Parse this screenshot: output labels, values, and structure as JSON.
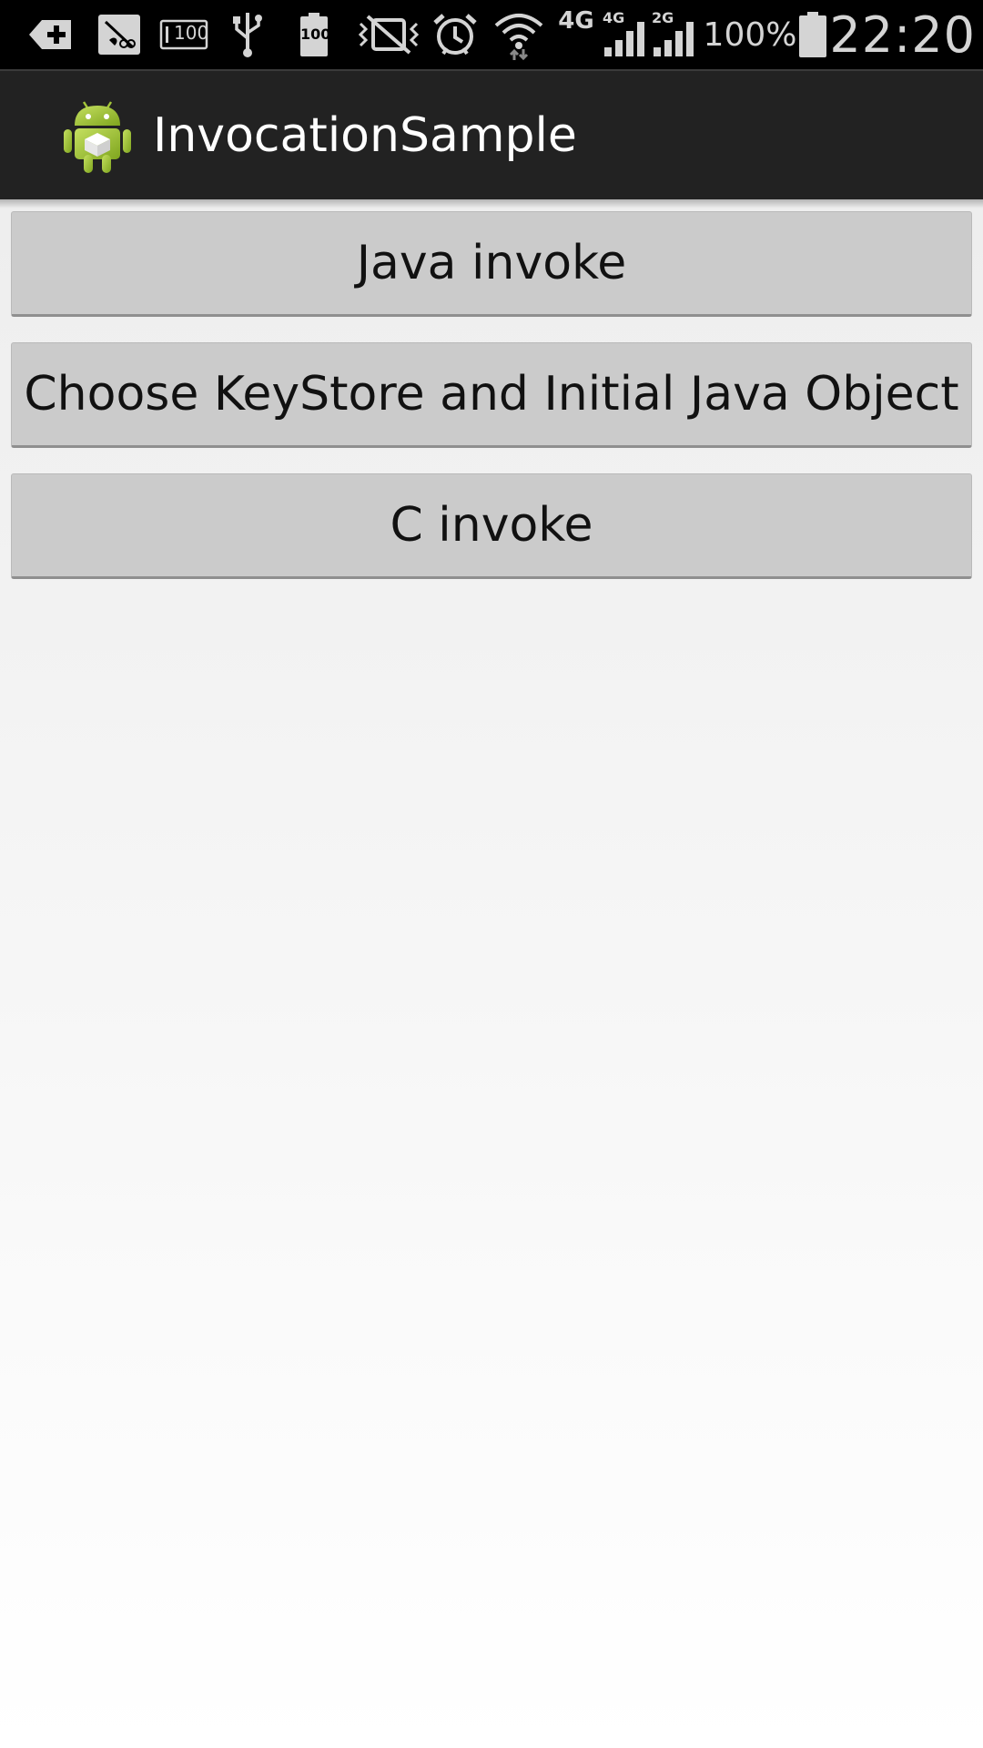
{
  "status_bar": {
    "icons": [
      "add-notification-icon",
      "screenshot-icon",
      "storage-100-icon",
      "usb-icon",
      "battery-100-icon",
      "mute-vibrate-icon",
      "alarm-icon",
      "wifi-icon",
      "signal-4g-icon",
      "signal-2g-icon",
      "battery-icon"
    ],
    "small_badge": "100",
    "net_label": "4G",
    "sim1_label": "4G",
    "sim2_label": "2G",
    "battery_pct": "100%",
    "clock": "22:20"
  },
  "action_bar": {
    "app_title": "InvocationSample",
    "icon": "android-app-icon"
  },
  "buttons": {
    "java_invoke": "Java invoke",
    "choose_keystore": "Choose KeyStore and Initial Java Object",
    "c_invoke": "C invoke"
  },
  "colors": {
    "status_bar_bg": "#000000",
    "action_bar_bg": "#222222",
    "button_bg": "#cbcbcb",
    "android_green": "#a4c639"
  }
}
